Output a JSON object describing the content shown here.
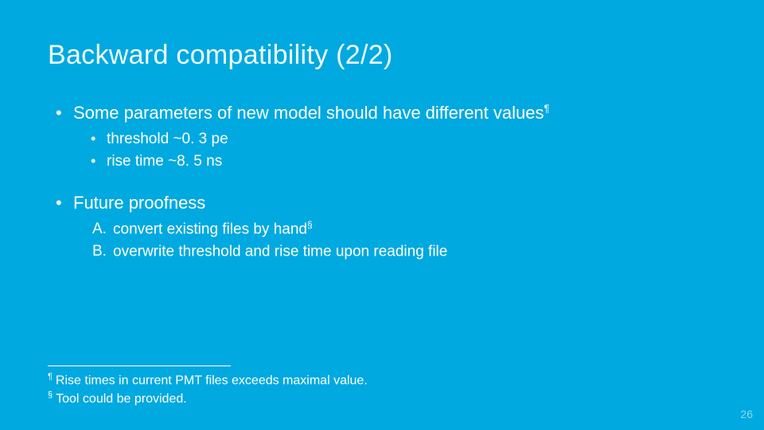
{
  "title": "Backward compatibility (2/2)",
  "b1": {
    "head": "Some parameters of new model should have different values",
    "sup": "¶",
    "items": [
      "threshold  ~0. 3  pe",
      "rise time   ~8. 5  ns"
    ]
  },
  "b2": {
    "head": "Future proofness",
    "items": [
      {
        "marker": "A.",
        "text": "convert existing files by hand",
        "sup": "§"
      },
      {
        "marker": "B.",
        "text": "overwrite threshold and rise time upon reading file",
        "sup": ""
      }
    ]
  },
  "footnotes": [
    {
      "sym": "¶",
      "text": "Rise times in current PMT files exceeds maximal value."
    },
    {
      "sym": "§",
      "text": "Tool could be provided."
    }
  ],
  "page": "26"
}
